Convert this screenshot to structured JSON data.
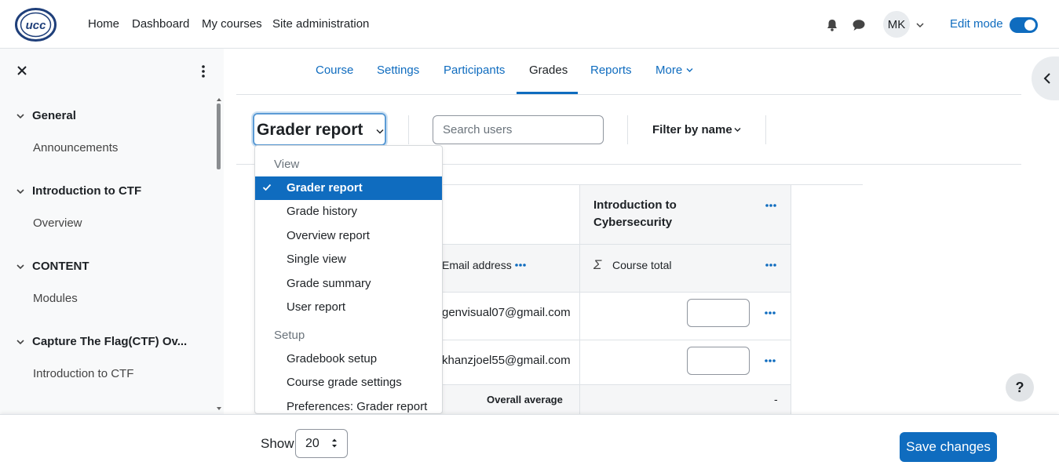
{
  "brand": {
    "logo_text": "ucc"
  },
  "nav": {
    "links": [
      "Home",
      "Dashboard",
      "My courses",
      "Site administration"
    ],
    "avatar_initials": "MK",
    "edit_mode_label": "Edit mode",
    "edit_mode_on": true
  },
  "drawer": {
    "sections": [
      {
        "title": "General",
        "items": [
          "Announcements"
        ]
      },
      {
        "title": "Introduction to CTF",
        "items": [
          "Overview"
        ]
      },
      {
        "title": "CONTENT",
        "items": [
          "Modules"
        ]
      },
      {
        "title": "Capture The Flag(CTF) Ov...",
        "items": [
          "Introduction to CTF"
        ]
      }
    ]
  },
  "secondary_nav": {
    "tabs": [
      "Course",
      "Settings",
      "Participants",
      "Grades",
      "Reports",
      "More"
    ],
    "active": "Grades"
  },
  "toolbar": {
    "report_select_label": "Grader report",
    "search_placeholder": "Search users",
    "filter_label": "Filter by name"
  },
  "dropdown": {
    "groups": [
      {
        "header": "View",
        "items": [
          "Grader report",
          "Grade history",
          "Overview report",
          "Single view",
          "Grade summary",
          "User report"
        ]
      },
      {
        "header": "Setup",
        "items": [
          "Gradebook setup",
          "Course grade settings",
          "Preferences: Grader report"
        ]
      }
    ],
    "selected": "Grader report"
  },
  "table": {
    "category_header": "Introduction to Cybersecurity",
    "email_header": "Email address",
    "course_total_header": "Course total",
    "rows": [
      {
        "email": "genvisual07@gmail.com",
        "grade": ""
      },
      {
        "email": "khanzjoel55@gmail.com",
        "grade": ""
      }
    ],
    "overall_average_label": "Overall average",
    "overall_average_value": "-"
  },
  "footer": {
    "show_label": "Show",
    "per_page": "20",
    "save_label": "Save changes"
  },
  "help_label": "?",
  "colors": {
    "accent": "#0f6cbf",
    "drawer_bg": "#f8f9fa"
  }
}
